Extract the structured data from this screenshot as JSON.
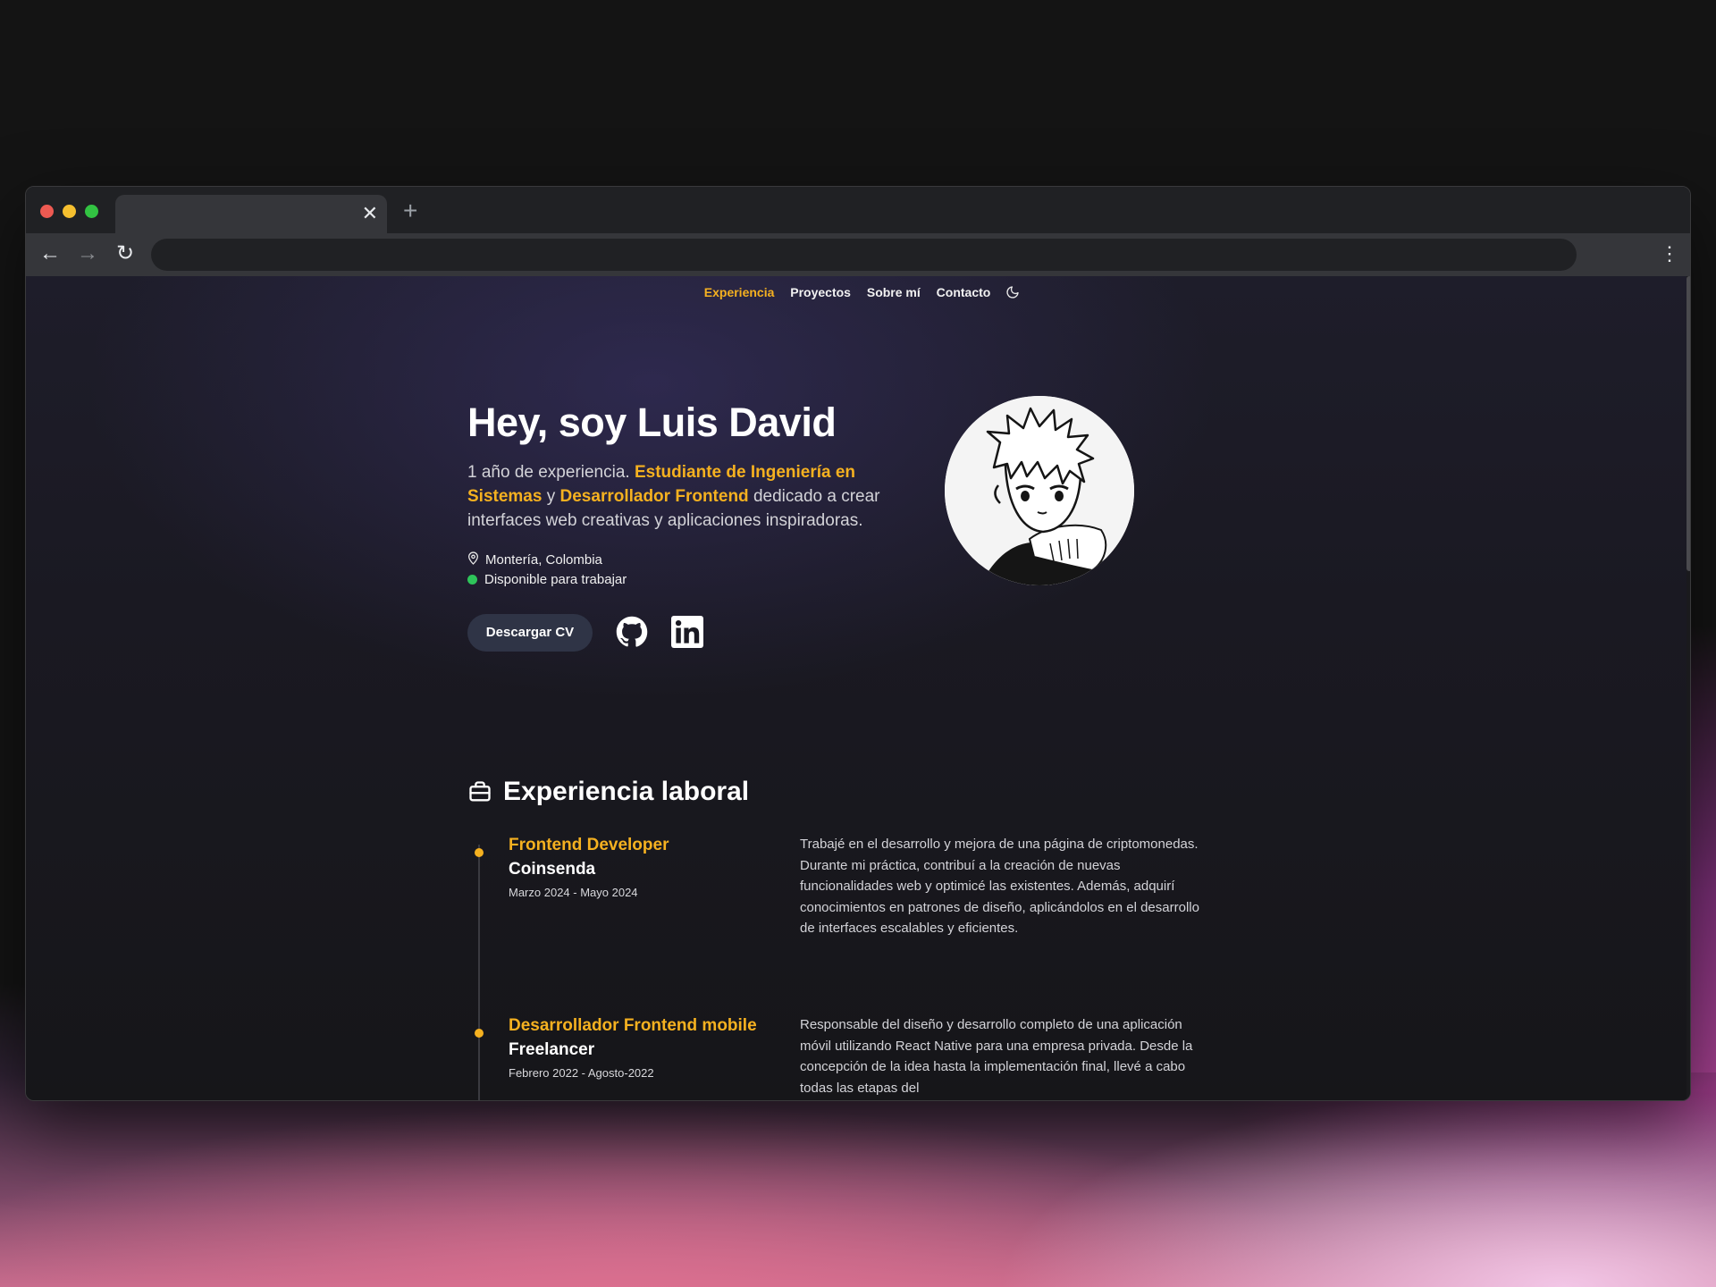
{
  "window": {
    "tab_close": "✕",
    "new_tab": "+",
    "back": "←",
    "forward": "→",
    "reload": "↻",
    "menu": "⋮"
  },
  "nav": {
    "items": [
      "Experiencia",
      "Proyectos",
      "Sobre mí",
      "Contacto"
    ],
    "active": "Experiencia",
    "theme_icon": "moon-icon"
  },
  "hero": {
    "title": "Hey, soy Luis David",
    "desc_part1": "1 año de experiencia. ",
    "desc_hl1": "Estudiante de Ingeniería en Sistemas",
    "desc_part2": " y ",
    "desc_hl2": "Desarrollador Frontend",
    "desc_part3": " dedicado a crear interfaces web creativas y aplicaciones inspiradoras.",
    "location": "Montería, Colombia",
    "availability": "Disponible para trabajar",
    "cv_button": "Descargar CV",
    "social_icons": [
      "github-icon",
      "linkedin-icon"
    ],
    "avatar_icon": "anime-avatar-icon"
  },
  "experience": {
    "title": "Experiencia laboral",
    "icon": "briefcase-icon",
    "jobs": [
      {
        "role": "Frontend Developer",
        "company": "Coinsenda",
        "dates": "Marzo 2024 - Mayo 2024",
        "description": "Trabajé en el desarrollo y mejora de una página de criptomonedas. Durante mi práctica, contribuí a la creación de nuevas funcionalidades web y optimicé las existentes. Además, adquirí conocimientos en patrones de diseño, aplicándolos en el desarrollo de interfaces escalables y eficientes."
      },
      {
        "role": "Desarrollador Frontend mobile",
        "company": "Freelancer",
        "dates": "Febrero 2022 - Agosto-2022",
        "description": "Responsable del diseño y desarrollo completo de una aplicación móvil utilizando React Native para una empresa privada. Desde la concepción de la idea hasta la implementación final, llevé a cabo todas las etapas del"
      }
    ]
  },
  "colors": {
    "accent": "#f5b120",
    "available": "#2ec45a",
    "button_bg": "#2f3446"
  }
}
